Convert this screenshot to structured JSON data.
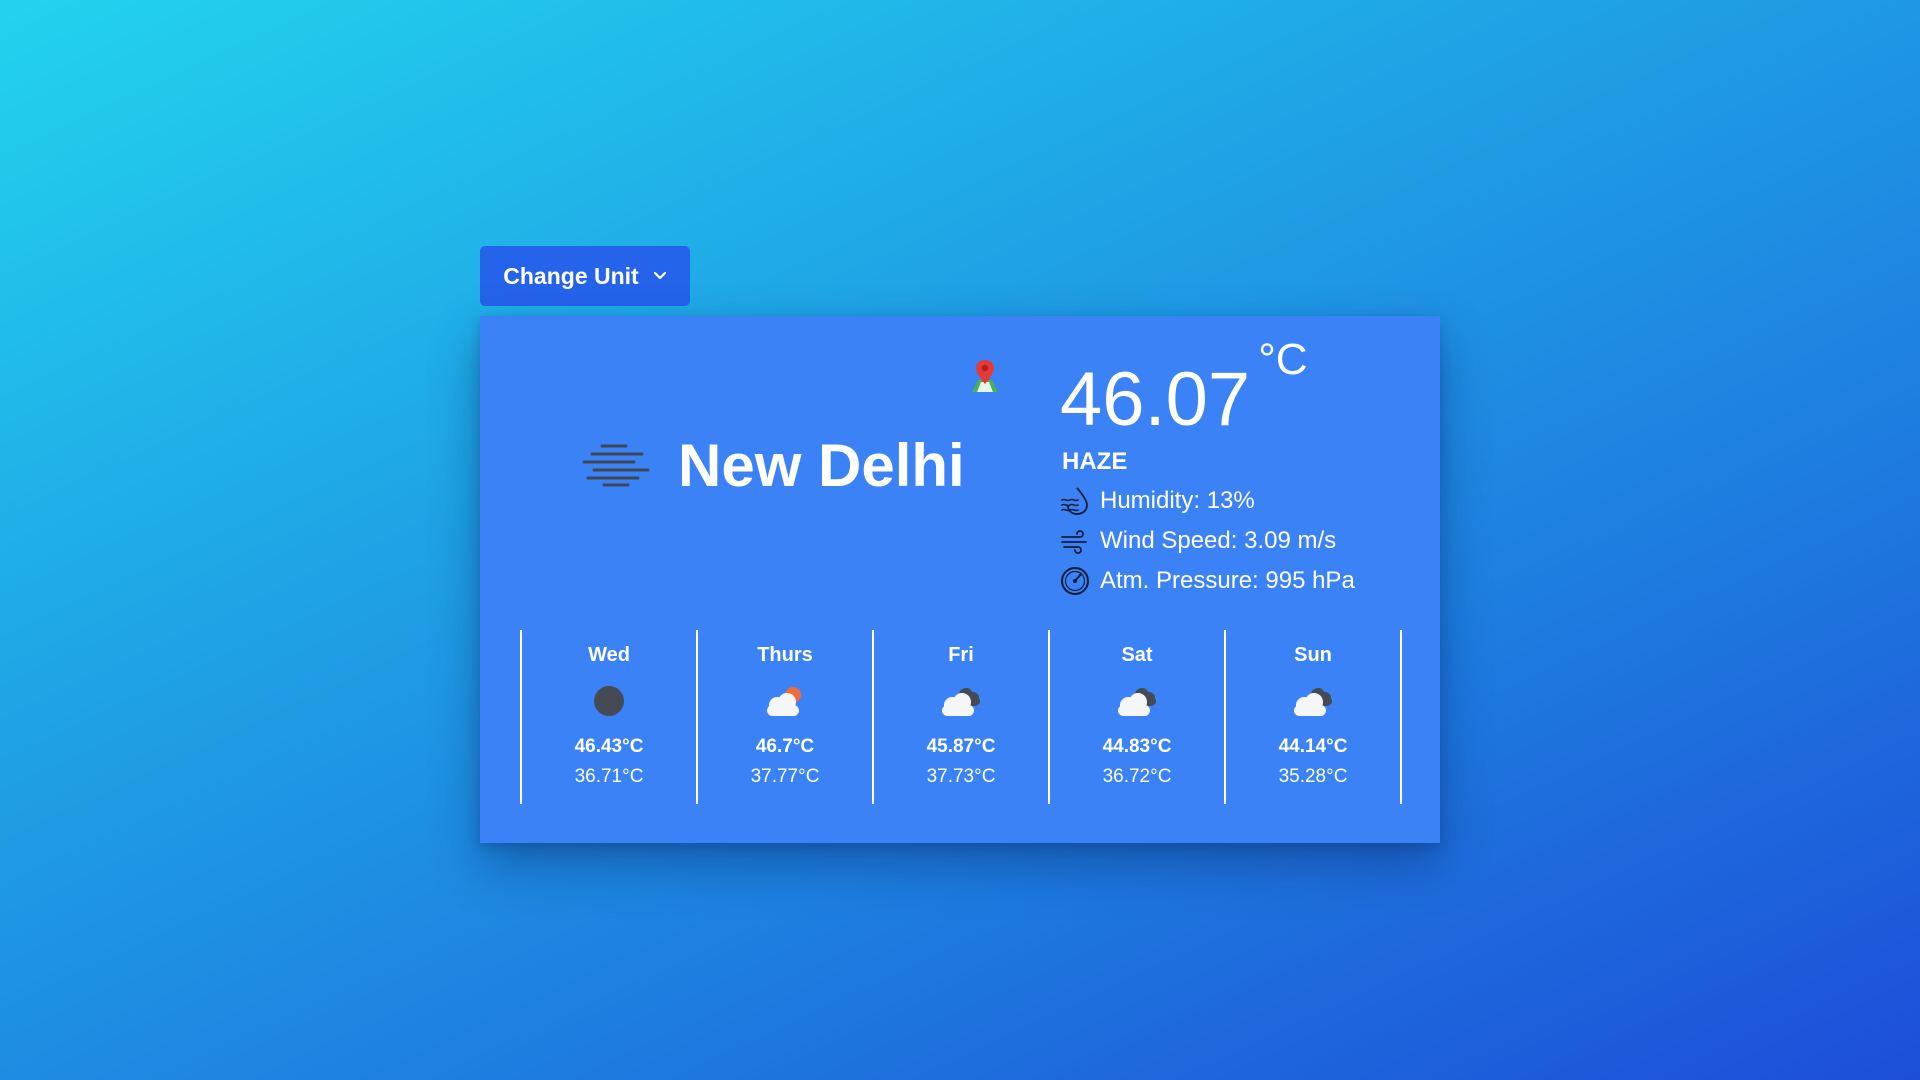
{
  "unit_menu": {
    "label": "Change Unit",
    "icon": "chevron-down-icon"
  },
  "current": {
    "city": "New Delhi",
    "city_icon": "haze-icon",
    "location_icon": "map-pin-icon",
    "temperature": "46.07",
    "unit": "°C",
    "condition": "HAZE",
    "humidity": "Humidity: 13%",
    "wind": "Wind Speed: 3.09 m/s",
    "pressure": "Atm. Pressure: 995 hPa"
  },
  "forecast": [
    {
      "day": "Wed",
      "icon": "night-clear-icon",
      "max": "46.43°C",
      "min": "36.71°C"
    },
    {
      "day": "Thurs",
      "icon": "partly-cloudy-icon",
      "max": "46.7°C",
      "min": "37.77°C"
    },
    {
      "day": "Fri",
      "icon": "cloudy-icon",
      "max": "45.87°C",
      "min": "37.73°C"
    },
    {
      "day": "Sat",
      "icon": "cloudy-icon",
      "max": "44.83°C",
      "min": "36.72°C"
    },
    {
      "day": "Sun",
      "icon": "cloudy-icon",
      "max": "44.14°C",
      "min": "35.28°C"
    }
  ],
  "colors": {
    "button": "#2563eb",
    "card": "#3b82f6",
    "text": "#ffffff"
  }
}
